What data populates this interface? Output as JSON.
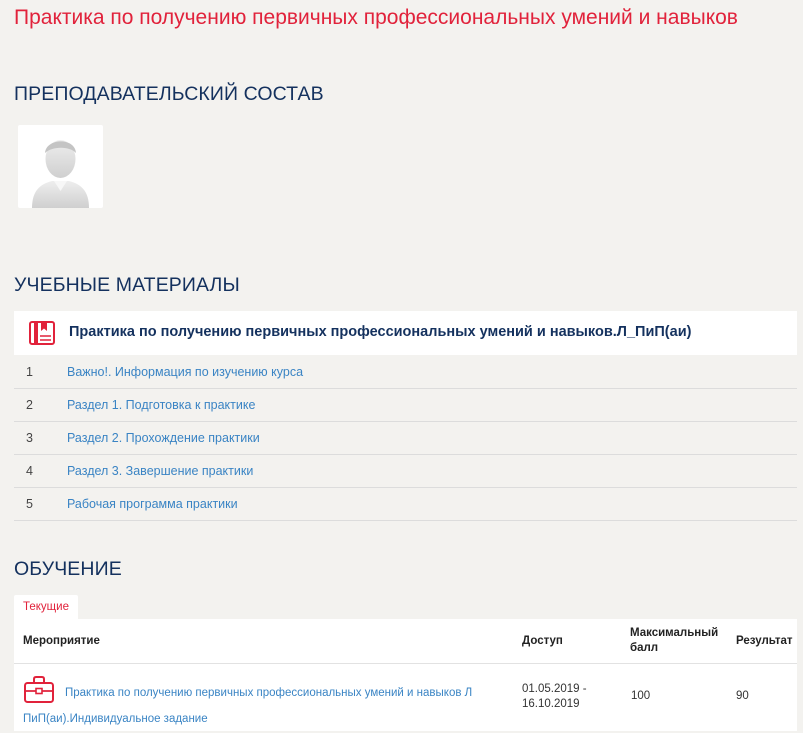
{
  "page": {
    "title": "Практика по получению первичных профессиональных умений и навыков"
  },
  "sections": {
    "staff": "ПРЕПОДАВАТЕЛЬСКИЙ СОСТАВ",
    "materials": "УЧЕБНЫЕ МАТЕРИАЛЫ",
    "education": "ОБУЧЕНИЕ"
  },
  "materials": {
    "header_title": "Практика по получению первичных профессиональных умений и навыков.Л_ПиП(аи)",
    "items": [
      {
        "num": "1",
        "label": "Важно!. Информация по изучению курса"
      },
      {
        "num": "2",
        "label": "Раздел 1. Подготовка к практике"
      },
      {
        "num": "3",
        "label": "Раздел 2. Прохождение практики"
      },
      {
        "num": "4",
        "label": "Раздел 3. Завершение практики"
      },
      {
        "num": "5",
        "label": "Рабочая программа практики"
      }
    ]
  },
  "education": {
    "tab_label": "Текущие",
    "columns": {
      "event": "Мероприятие",
      "access": "Доступ",
      "max_score": "Максимальный балл",
      "result": "Результат"
    },
    "rows": [
      {
        "event": "Практика по получению первичных профессиональных умений и навыков Л ПиП(аи).Индивидуальное задание",
        "access_from": "01.05.2019 -",
        "access_to": "16.10.2019",
        "max_score": "100",
        "result": "90"
      }
    ]
  },
  "colors": {
    "accent_red": "#e1223b",
    "heading_navy": "#14315e",
    "link_blue": "#3a84c4",
    "background": "#f3f2ef"
  },
  "icons": {
    "avatar": "user-silhouette-icon",
    "materials": "book-icon",
    "event": "briefcase-icon"
  }
}
